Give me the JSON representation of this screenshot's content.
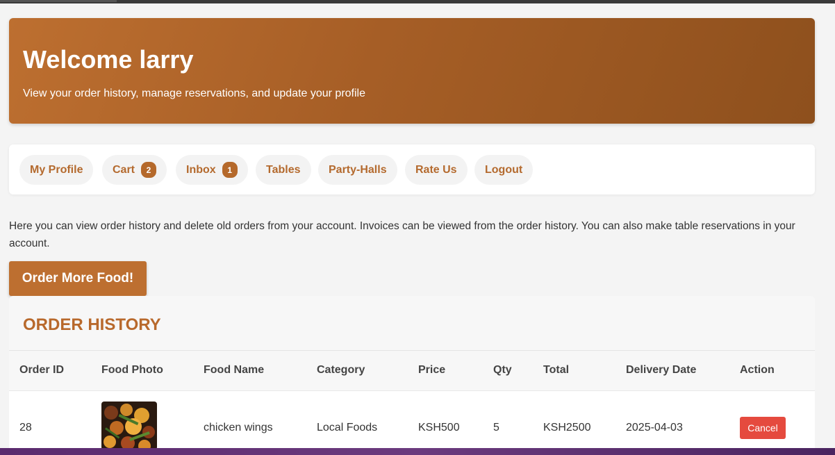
{
  "hero": {
    "title": "Welcome larry",
    "subtitle": "View your order history, manage reservations, and update your profile"
  },
  "nav": {
    "items": [
      {
        "label": "My Profile"
      },
      {
        "label": "Cart",
        "badge": "2"
      },
      {
        "label": "Inbox",
        "badge": "1"
      },
      {
        "label": "Tables"
      },
      {
        "label": "Party-Halls"
      },
      {
        "label": "Rate Us"
      },
      {
        "label": "Logout"
      }
    ]
  },
  "intro": "Here you can view order history and delete old orders from your account. Invoices can be viewed from the order history. You can also make table reservations in your account.",
  "order_button": "Order More Food!",
  "history": {
    "title": "ORDER HISTORY",
    "columns": [
      "Order ID",
      "Food Photo",
      "Food Name",
      "Category",
      "Price",
      "Qty",
      "Total",
      "Delivery Date",
      "Action"
    ],
    "rows": [
      {
        "order_id": "28",
        "food_name": "chicken wings",
        "category": "Local Foods",
        "price": "KSH500",
        "qty": "5",
        "total": "KSH2500",
        "delivery_date": "2025-04-03",
        "action": "Cancel"
      }
    ]
  },
  "colors": {
    "brand": "#bd6f30",
    "badge": "#b5692b",
    "danger": "#e54a3e"
  }
}
